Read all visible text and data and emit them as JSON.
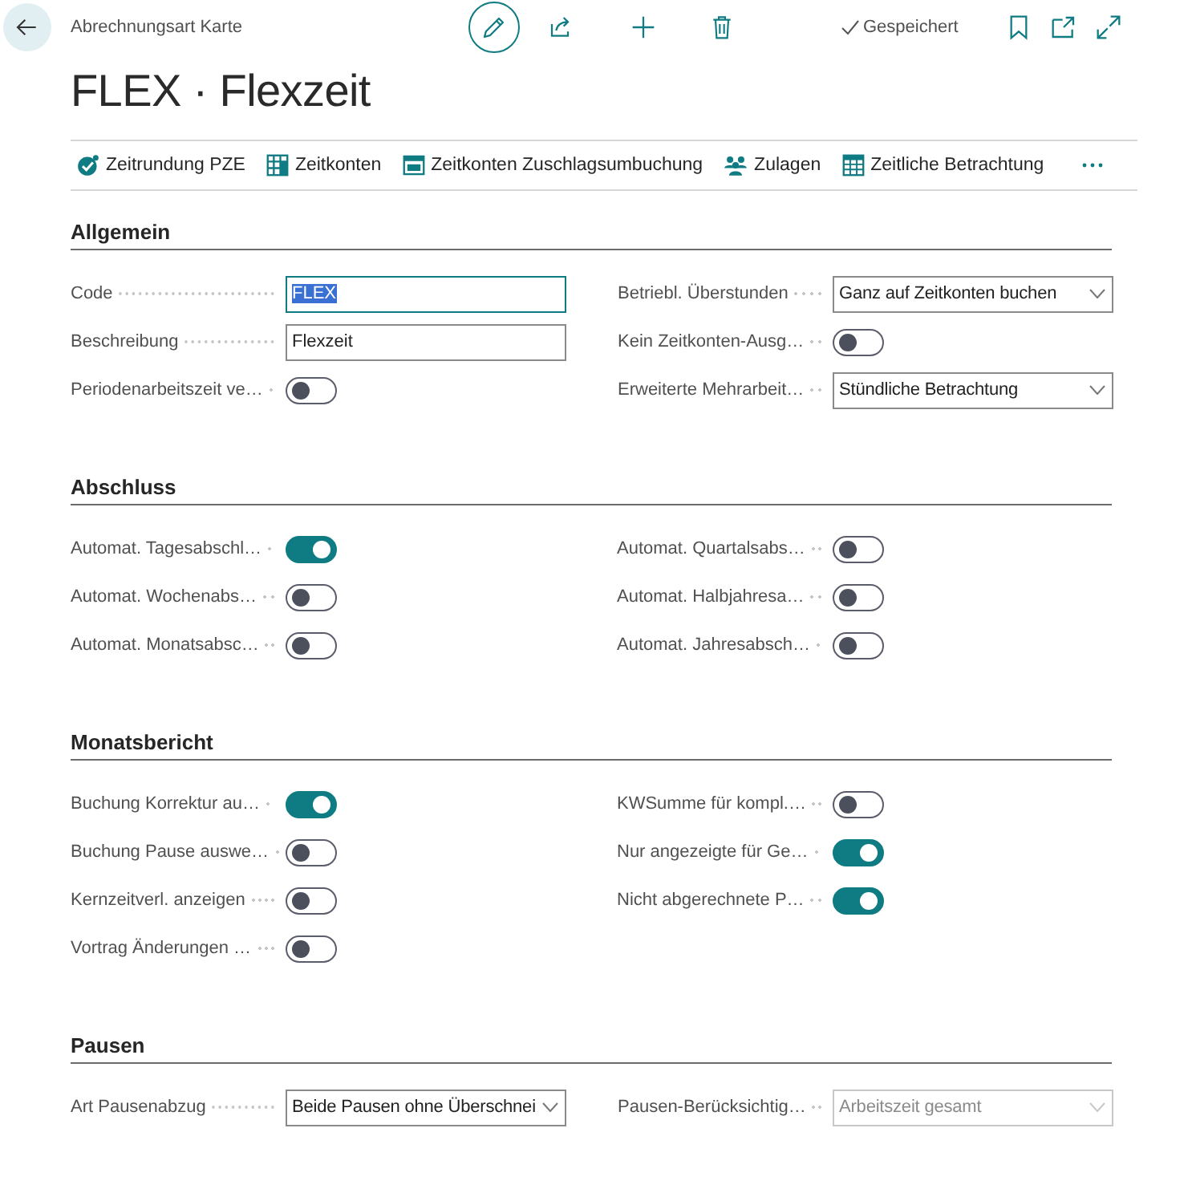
{
  "header": {
    "breadcrumb": "Abrechnungsart Karte",
    "edit_active": true,
    "save_status": "Gespeichert"
  },
  "title": "FLEX · Flexzeit",
  "actions": [
    {
      "label": "Zeitrundung PZE"
    },
    {
      "label": "Zeitkonten"
    },
    {
      "label": "Zeitkonten Zuschlagsumbuchung"
    },
    {
      "label": "Zulagen"
    },
    {
      "label": "Zeitliche Betrachtung"
    }
  ],
  "sections": [
    {
      "title": "Allgemein",
      "columns": [
        [
          {
            "kind": "text",
            "label": "Code",
            "value": "FLEX",
            "focused": true,
            "text_selected": true
          },
          {
            "kind": "text",
            "label": "Beschreibung",
            "value": "Flexzeit",
            "focused": false,
            "text_selected": false
          },
          {
            "kind": "toggle",
            "label": "Periodenarbeitszeit ve…",
            "on": false
          }
        ],
        [
          {
            "kind": "dropdown",
            "label": "Betriebl. Überstunden",
            "value": "Ganz auf Zeitkonten buchen",
            "disabled": false
          },
          {
            "kind": "toggle",
            "label": "Kein Zeitkonten-Ausg…",
            "on": false
          },
          {
            "kind": "dropdown",
            "label": "Erweiterte Mehrarbeit…",
            "value": "Stündliche Betrachtung",
            "disabled": false
          }
        ]
      ]
    },
    {
      "title": "Abschluss",
      "columns": [
        [
          {
            "kind": "toggle",
            "label": "Automat. Tagesabschl…",
            "on": true
          },
          {
            "kind": "toggle",
            "label": "Automat. Wochenabs…",
            "on": false
          },
          {
            "kind": "toggle",
            "label": "Automat. Monatsabsc…",
            "on": false
          }
        ],
        [
          {
            "kind": "toggle",
            "label": "Automat. Quartalsabs…",
            "on": false
          },
          {
            "kind": "toggle",
            "label": "Automat. Halbjahresa…",
            "on": false
          },
          {
            "kind": "toggle",
            "label": "Automat. Jahresabsch…",
            "on": false
          }
        ]
      ]
    },
    {
      "title": "Monatsbericht",
      "columns": [
        [
          {
            "kind": "toggle",
            "label": "Buchung Korrektur au…",
            "on": true
          },
          {
            "kind": "toggle",
            "label": "Buchung Pause auswe…",
            "on": false
          },
          {
            "kind": "toggle",
            "label": "Kernzeitverl. anzeigen",
            "on": false
          },
          {
            "kind": "toggle",
            "label": "Vortrag Änderungen …",
            "on": false
          }
        ],
        [
          {
            "kind": "toggle",
            "label": "KWSumme für kompl.…",
            "on": false
          },
          {
            "kind": "toggle",
            "label": "Nur angezeigte für Ge…",
            "on": true
          },
          {
            "kind": "toggle",
            "label": "Nicht abgerechnete P…",
            "on": true
          }
        ]
      ]
    },
    {
      "title": "Pausen",
      "columns": [
        [
          {
            "kind": "dropdown",
            "label": "Art Pausenabzug",
            "value": "Beide Pausen ohne Überschnei",
            "disabled": false
          }
        ],
        [
          {
            "kind": "dropdown",
            "label": "Pausen-Berücksichtig…",
            "value": "Arbeitszeit gesamt",
            "disabled": true
          }
        ]
      ]
    }
  ]
}
